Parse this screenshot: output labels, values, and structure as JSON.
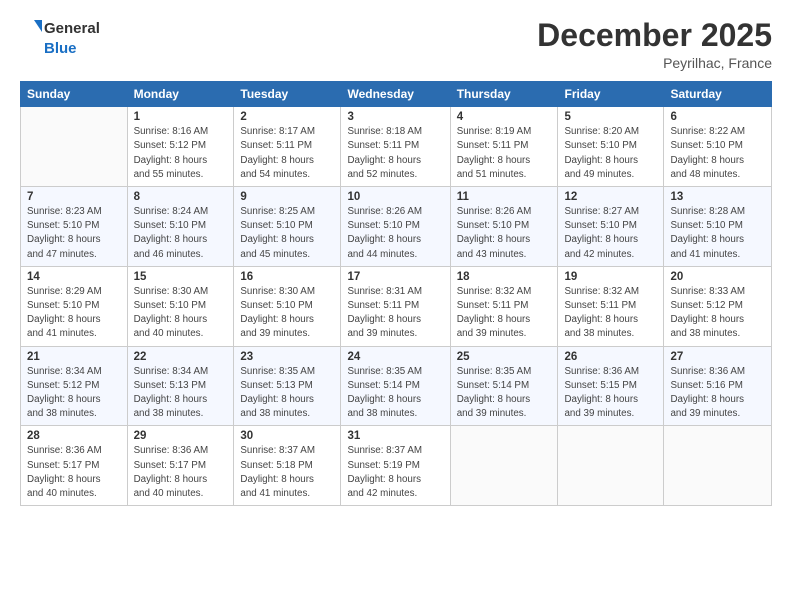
{
  "logo": {
    "line1": "General",
    "line2": "Blue"
  },
  "header": {
    "month": "December 2025",
    "location": "Peyrilhac, France"
  },
  "columns": [
    "Sunday",
    "Monday",
    "Tuesday",
    "Wednesday",
    "Thursday",
    "Friday",
    "Saturday"
  ],
  "weeks": [
    [
      {
        "day": "",
        "detail": ""
      },
      {
        "day": "1",
        "detail": "Sunrise: 8:16 AM\nSunset: 5:12 PM\nDaylight: 8 hours\nand 55 minutes."
      },
      {
        "day": "2",
        "detail": "Sunrise: 8:17 AM\nSunset: 5:11 PM\nDaylight: 8 hours\nand 54 minutes."
      },
      {
        "day": "3",
        "detail": "Sunrise: 8:18 AM\nSunset: 5:11 PM\nDaylight: 8 hours\nand 52 minutes."
      },
      {
        "day": "4",
        "detail": "Sunrise: 8:19 AM\nSunset: 5:11 PM\nDaylight: 8 hours\nand 51 minutes."
      },
      {
        "day": "5",
        "detail": "Sunrise: 8:20 AM\nSunset: 5:10 PM\nDaylight: 8 hours\nand 49 minutes."
      },
      {
        "day": "6",
        "detail": "Sunrise: 8:22 AM\nSunset: 5:10 PM\nDaylight: 8 hours\nand 48 minutes."
      }
    ],
    [
      {
        "day": "7",
        "detail": "Sunrise: 8:23 AM\nSunset: 5:10 PM\nDaylight: 8 hours\nand 47 minutes."
      },
      {
        "day": "8",
        "detail": "Sunrise: 8:24 AM\nSunset: 5:10 PM\nDaylight: 8 hours\nand 46 minutes."
      },
      {
        "day": "9",
        "detail": "Sunrise: 8:25 AM\nSunset: 5:10 PM\nDaylight: 8 hours\nand 45 minutes."
      },
      {
        "day": "10",
        "detail": "Sunrise: 8:26 AM\nSunset: 5:10 PM\nDaylight: 8 hours\nand 44 minutes."
      },
      {
        "day": "11",
        "detail": "Sunrise: 8:26 AM\nSunset: 5:10 PM\nDaylight: 8 hours\nand 43 minutes."
      },
      {
        "day": "12",
        "detail": "Sunrise: 8:27 AM\nSunset: 5:10 PM\nDaylight: 8 hours\nand 42 minutes."
      },
      {
        "day": "13",
        "detail": "Sunrise: 8:28 AM\nSunset: 5:10 PM\nDaylight: 8 hours\nand 41 minutes."
      }
    ],
    [
      {
        "day": "14",
        "detail": "Sunrise: 8:29 AM\nSunset: 5:10 PM\nDaylight: 8 hours\nand 41 minutes."
      },
      {
        "day": "15",
        "detail": "Sunrise: 8:30 AM\nSunset: 5:10 PM\nDaylight: 8 hours\nand 40 minutes."
      },
      {
        "day": "16",
        "detail": "Sunrise: 8:30 AM\nSunset: 5:10 PM\nDaylight: 8 hours\nand 39 minutes."
      },
      {
        "day": "17",
        "detail": "Sunrise: 8:31 AM\nSunset: 5:11 PM\nDaylight: 8 hours\nand 39 minutes."
      },
      {
        "day": "18",
        "detail": "Sunrise: 8:32 AM\nSunset: 5:11 PM\nDaylight: 8 hours\nand 39 minutes."
      },
      {
        "day": "19",
        "detail": "Sunrise: 8:32 AM\nSunset: 5:11 PM\nDaylight: 8 hours\nand 38 minutes."
      },
      {
        "day": "20",
        "detail": "Sunrise: 8:33 AM\nSunset: 5:12 PM\nDaylight: 8 hours\nand 38 minutes."
      }
    ],
    [
      {
        "day": "21",
        "detail": "Sunrise: 8:34 AM\nSunset: 5:12 PM\nDaylight: 8 hours\nand 38 minutes."
      },
      {
        "day": "22",
        "detail": "Sunrise: 8:34 AM\nSunset: 5:13 PM\nDaylight: 8 hours\nand 38 minutes."
      },
      {
        "day": "23",
        "detail": "Sunrise: 8:35 AM\nSunset: 5:13 PM\nDaylight: 8 hours\nand 38 minutes."
      },
      {
        "day": "24",
        "detail": "Sunrise: 8:35 AM\nSunset: 5:14 PM\nDaylight: 8 hours\nand 38 minutes."
      },
      {
        "day": "25",
        "detail": "Sunrise: 8:35 AM\nSunset: 5:14 PM\nDaylight: 8 hours\nand 39 minutes."
      },
      {
        "day": "26",
        "detail": "Sunrise: 8:36 AM\nSunset: 5:15 PM\nDaylight: 8 hours\nand 39 minutes."
      },
      {
        "day": "27",
        "detail": "Sunrise: 8:36 AM\nSunset: 5:16 PM\nDaylight: 8 hours\nand 39 minutes."
      }
    ],
    [
      {
        "day": "28",
        "detail": "Sunrise: 8:36 AM\nSunset: 5:17 PM\nDaylight: 8 hours\nand 40 minutes."
      },
      {
        "day": "29",
        "detail": "Sunrise: 8:36 AM\nSunset: 5:17 PM\nDaylight: 8 hours\nand 40 minutes."
      },
      {
        "day": "30",
        "detail": "Sunrise: 8:37 AM\nSunset: 5:18 PM\nDaylight: 8 hours\nand 41 minutes."
      },
      {
        "day": "31",
        "detail": "Sunrise: 8:37 AM\nSunset: 5:19 PM\nDaylight: 8 hours\nand 42 minutes."
      },
      {
        "day": "",
        "detail": ""
      },
      {
        "day": "",
        "detail": ""
      },
      {
        "day": "",
        "detail": ""
      }
    ]
  ]
}
